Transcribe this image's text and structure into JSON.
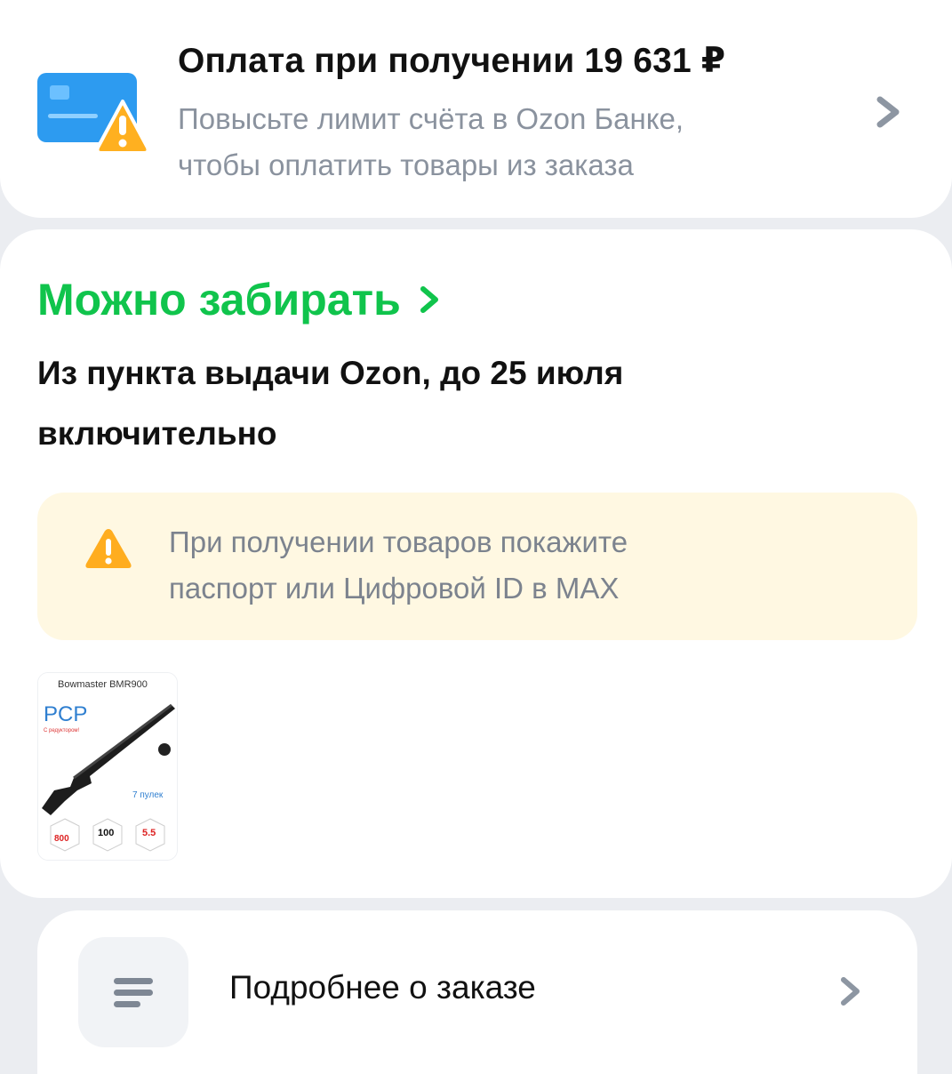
{
  "payment": {
    "title": "Оплата при получении 19 631 ₽",
    "subtitle_line1": "Повысьте лимит счёта в Ozon Банке,",
    "subtitle_line2": "чтобы оплатить товары из заказа",
    "icon": "card-warning-icon"
  },
  "order": {
    "status": "Можно забирать",
    "status_color": "#10c44c",
    "pickup_line1": "Из пункта выдачи Ozon, до 25 июля",
    "pickup_line2": "включительно",
    "notice": {
      "line1": "При получении товаров покажите",
      "line2": "паспорт или Цифровой ID в MAX",
      "background": "#fff8e2",
      "icon": "warning-icon"
    },
    "product": {
      "name": "Bowmaster BMR900",
      "badge": "PCP",
      "tagline": "С редуктором!",
      "bullets": "7 пулек",
      "stat1": "800",
      "stat2": "100",
      "stat3": "5.5"
    }
  },
  "details": {
    "label": "Подробнее о заказе",
    "icon": "list-icon"
  }
}
